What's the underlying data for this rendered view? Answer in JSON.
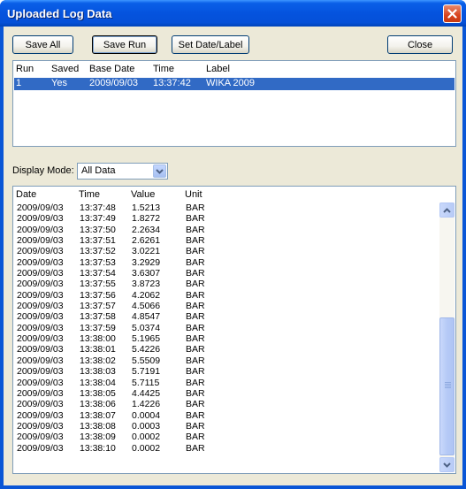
{
  "window": {
    "title": "Uploaded Log Data"
  },
  "toolbar": {
    "save_all": "Save All",
    "save_run": "Save Run",
    "set_date_label": "Set Date/Label",
    "close": "Close"
  },
  "runs": {
    "headers": [
      "Run",
      "Saved",
      "Base Date",
      "Time",
      "Label"
    ],
    "rows": [
      {
        "run": "1",
        "saved": "Yes",
        "base_date": "2009/09/03",
        "time": "13:37:42",
        "label": "WIKA 2009"
      }
    ]
  },
  "display_mode": {
    "label": "Display Mode:",
    "value": "All Data"
  },
  "data": {
    "headers": [
      "Date",
      "Time",
      "Value",
      "Unit"
    ],
    "rows": [
      [
        "2009/09/03",
        "13:37:48",
        "1.5213",
        "BAR"
      ],
      [
        "2009/09/03",
        "13:37:49",
        "1.8272",
        "BAR"
      ],
      [
        "2009/09/03",
        "13:37:50",
        "2.2634",
        "BAR"
      ],
      [
        "2009/09/03",
        "13:37:51",
        "2.6261",
        "BAR"
      ],
      [
        "2009/09/03",
        "13:37:52",
        "3.0221",
        "BAR"
      ],
      [
        "2009/09/03",
        "13:37:53",
        "3.2929",
        "BAR"
      ],
      [
        "2009/09/03",
        "13:37:54",
        "3.6307",
        "BAR"
      ],
      [
        "2009/09/03",
        "13:37:55",
        "3.8723",
        "BAR"
      ],
      [
        "2009/09/03",
        "13:37:56",
        "4.2062",
        "BAR"
      ],
      [
        "2009/09/03",
        "13:37:57",
        "4.5066",
        "BAR"
      ],
      [
        "2009/09/03",
        "13:37:58",
        "4.8547",
        "BAR"
      ],
      [
        "2009/09/03",
        "13:37:59",
        "5.0374",
        "BAR"
      ],
      [
        "2009/09/03",
        "13:38:00",
        "5.1965",
        "BAR"
      ],
      [
        "2009/09/03",
        "13:38:01",
        "5.4226",
        "BAR"
      ],
      [
        "2009/09/03",
        "13:38:02",
        "5.5509",
        "BAR"
      ],
      [
        "2009/09/03",
        "13:38:03",
        "5.7191",
        "BAR"
      ],
      [
        "2009/09/03",
        "13:38:04",
        "5.7115",
        "BAR"
      ],
      [
        "2009/09/03",
        "13:38:05",
        "4.4425",
        "BAR"
      ],
      [
        "2009/09/03",
        "13:38:06",
        "1.4226",
        "BAR"
      ],
      [
        "2009/09/03",
        "13:38:07",
        "0.0004",
        "BAR"
      ],
      [
        "2009/09/03",
        "13:38:08",
        "0.0003",
        "BAR"
      ],
      [
        "2009/09/03",
        "13:38:09",
        "0.0002",
        "BAR"
      ],
      [
        "2009/09/03",
        "13:38:10",
        "0.0002",
        "BAR"
      ]
    ]
  },
  "icons": {
    "close": "close-icon",
    "dropdown": "chevron-down-icon",
    "scroll_up": "arrow-up-icon",
    "scroll_down": "arrow-down-icon"
  },
  "colors": {
    "title_bar": "#0553de",
    "selection": "#316ac5",
    "dialog_bg": "#ece9d8"
  }
}
